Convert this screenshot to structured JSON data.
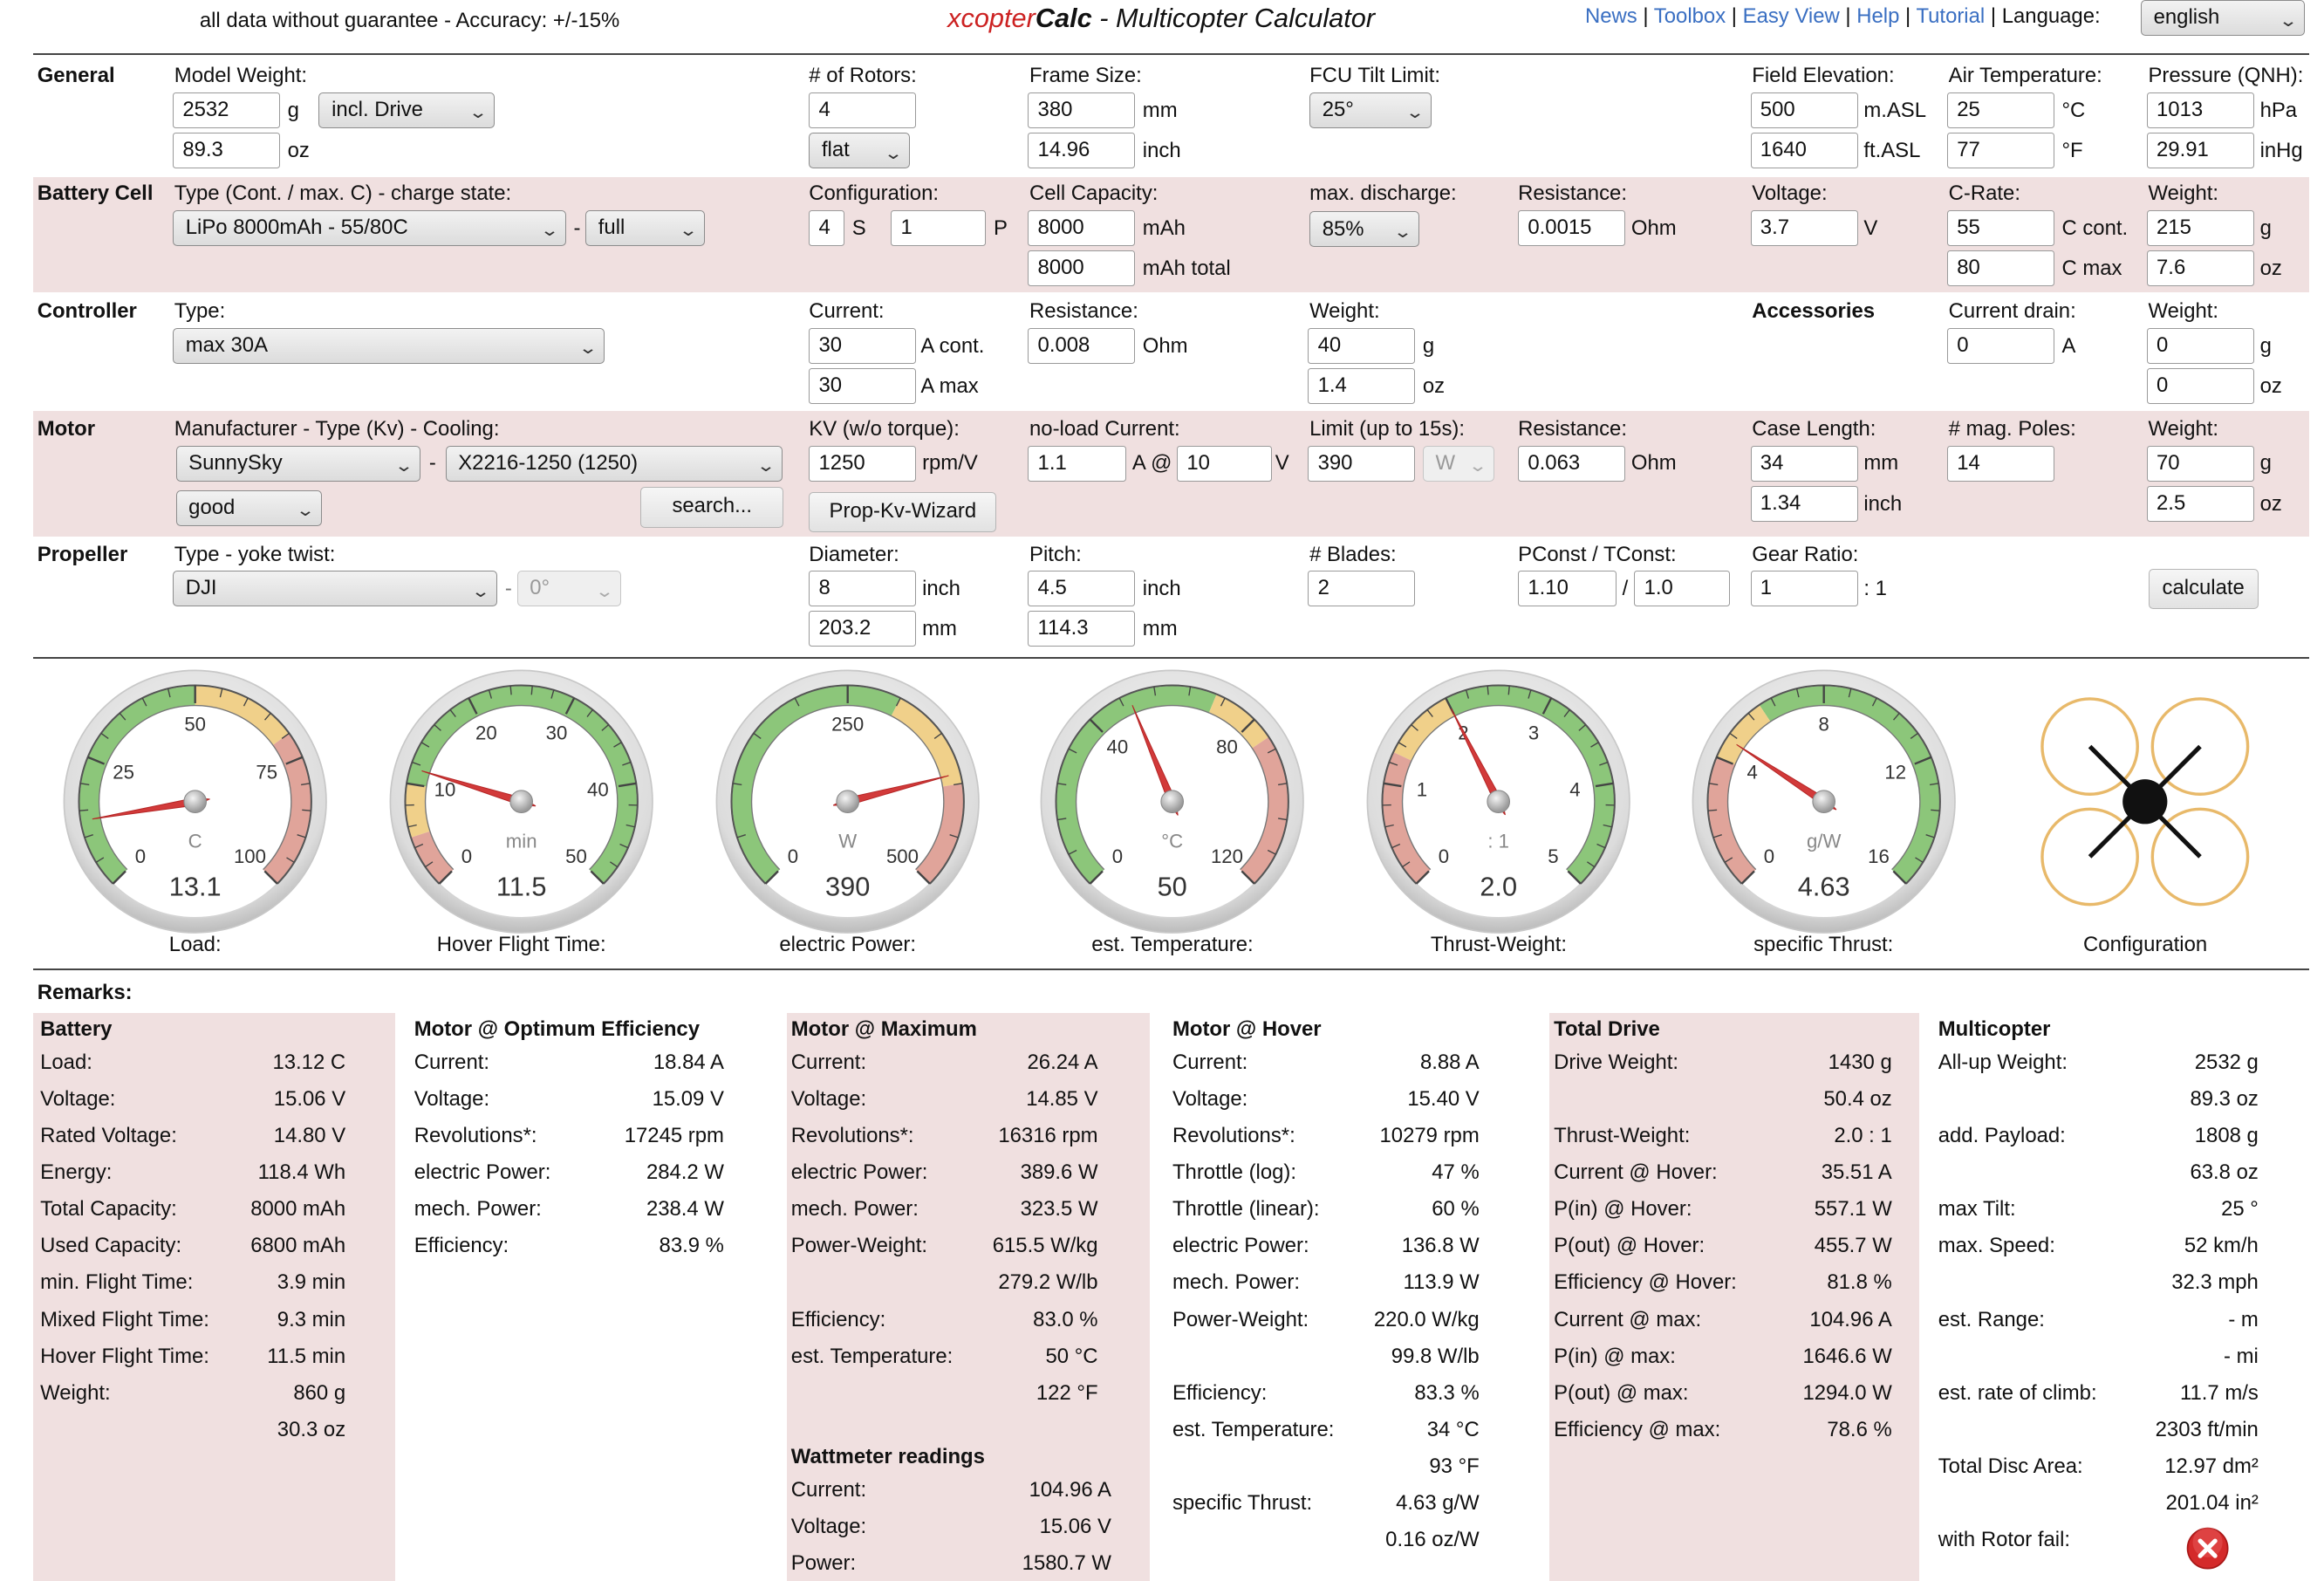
{
  "header": {
    "disclaimer": "all data without guarantee - Accuracy: +/-15%",
    "brand_xcopter": "xcopter",
    "brand_calc": "Calc",
    "brand_rest": " - Multicopter Calculator",
    "nav": [
      "News",
      "Toolbox",
      "Easy View",
      "Help",
      "Tutorial"
    ],
    "language_label": "Language:",
    "language_value": "english"
  },
  "general": {
    "section": "General",
    "model_weight_label": "Model Weight:",
    "model_weight_g": "2532",
    "unit_g": "g",
    "drive_option": "incl. Drive",
    "model_weight_oz": "89.3",
    "unit_oz": "oz",
    "rotors_label": "# of Rotors:",
    "rotors": "4",
    "layout": "flat",
    "frame_label": "Frame Size:",
    "frame_mm": "380",
    "unit_mm": "mm",
    "frame_inch": "14.96",
    "unit_inch": "inch",
    "fcu_label": "FCU Tilt Limit:",
    "fcu_value": "25°",
    "elev_label": "Field Elevation:",
    "elev_m": "500",
    "unit_masl": "m.ASL",
    "elev_ft": "1640",
    "unit_ftasl": "ft.ASL",
    "air_label": "Air Temperature:",
    "air_c": "25",
    "unit_c": "°C",
    "air_f": "77",
    "unit_f": "°F",
    "pressure_label": "Pressure (QNH):",
    "pressure_hpa": "1013",
    "unit_hpa": "hPa",
    "pressure_inhg": "29.91",
    "unit_inhg": "inHg"
  },
  "battery": {
    "section": "Battery Cell",
    "type_label": "Type (Cont. / max. C) - charge state:",
    "type_value": "LiPo 8000mAh - 55/80C",
    "dash": "-",
    "charge_value": "full",
    "config_label": "Configuration:",
    "s_value": "4",
    "unit_s": "S",
    "p_value": "1",
    "unit_p": "P",
    "capacity_label": "Cell Capacity:",
    "capacity": "8000",
    "unit_mah": "mAh",
    "capacity_total": "8000",
    "unit_mah_total": "mAh total",
    "discharge_label": "max. discharge:",
    "discharge_value": "85%",
    "resistance_label": "Resistance:",
    "resistance": "0.0015",
    "unit_ohm": "Ohm",
    "voltage_label": "Voltage:",
    "voltage": "3.7",
    "unit_v": "V",
    "crate_label": "C-Rate:",
    "c_cont": "55",
    "unit_ccont": "C cont.",
    "c_max": "80",
    "unit_cmax": "C max",
    "weight_label": "Weight:",
    "weight_g": "215",
    "weight_oz": "7.6"
  },
  "controller": {
    "section": "Controller",
    "type_label": "Type:",
    "type_value": "max 30A",
    "current_label": "Current:",
    "current_cont": "30",
    "unit_acont": "A cont.",
    "current_max": "30",
    "unit_amax": "A max",
    "resistance_label": "Resistance:",
    "resistance": "0.008",
    "weight_label": "Weight:",
    "weight_g": "40",
    "weight_oz": "1.4",
    "acc_section": "Accessories",
    "drain_label": "Current drain:",
    "drain": "0",
    "unit_a": "A",
    "acc_weight_label": "Weight:",
    "acc_weight_g": "0",
    "acc_weight_oz": "0"
  },
  "motor": {
    "section": "Motor",
    "type_label": "Manufacturer - Type (Kv) - Cooling:",
    "manufacturer": "SunnySky",
    "model": "X2216-1250 (1250)",
    "cooling": "good",
    "search": "search...",
    "kv_label": "KV (w/o torque):",
    "kv": "1250",
    "unit_rpmv": "rpm/V",
    "wizard": "Prop-Kv-Wizard",
    "noload_label": "no-load Current:",
    "noload_a": "1.1",
    "unit_aat": "A @",
    "noload_v": "10",
    "limit_label": "Limit (up to 15s):",
    "limit": "390",
    "limit_unit": "W",
    "resistance_label": "Resistance:",
    "resistance": "0.063",
    "case_label": "Case Length:",
    "case_mm": "34",
    "case_inch": "1.34",
    "poles_label": "# mag. Poles:",
    "poles": "14",
    "weight_label": "Weight:",
    "weight_g": "70",
    "weight_oz": "2.5"
  },
  "propeller": {
    "section": "Propeller",
    "type_label": "Type - yoke twist:",
    "type_value": "DJI",
    "twist": "0°",
    "diameter_label": "Diameter:",
    "diameter_inch": "8",
    "diameter_mm": "203.2",
    "pitch_label": "Pitch:",
    "pitch_inch": "4.5",
    "pitch_mm": "114.3",
    "blades_label": "# Blades:",
    "blades": "2",
    "pconst_label": "PConst / TConst:",
    "pconst": "1.10",
    "slash": "/",
    "tconst": "1.0",
    "gear_label": "Gear Ratio:",
    "gear": "1",
    "gear_unit": ": 1",
    "calculate": "calculate"
  },
  "gauges": [
    {
      "caption": "Load:",
      "unit": "C",
      "value": "13.1",
      "ticks": [
        "0",
        "25",
        "50",
        "75",
        "100"
      ],
      "min": 0,
      "max": 100,
      "needle": 13.1,
      "green": [
        0,
        50
      ],
      "yellow": [
        50,
        70
      ],
      "red": [
        70,
        100
      ]
    },
    {
      "caption": "Hover Flight Time:",
      "unit": "min",
      "value": "11.5",
      "ticks": [
        "0",
        "10",
        "20",
        "30",
        "40",
        "50"
      ],
      "min": 0,
      "max": 50,
      "needle": 11.5,
      "red": [
        0,
        5
      ],
      "yellow": [
        5,
        10
      ],
      "green": [
        10,
        50
      ]
    },
    {
      "caption": "electric Power:",
      "unit": "W",
      "value": "390",
      "ticks": [
        "0",
        "250",
        "500"
      ],
      "min": 0,
      "max": 500,
      "needle": 390,
      "green": [
        0,
        300
      ],
      "yellow": [
        300,
        400
      ],
      "red": [
        400,
        500
      ]
    },
    {
      "caption": "est. Temperature:",
      "unit": "°C",
      "value": "50",
      "ticks": [
        "0",
        "40",
        "80",
        "120"
      ],
      "min": 0,
      "max": 120,
      "needle": 50,
      "green": [
        0,
        70
      ],
      "yellow": [
        70,
        85
      ],
      "red": [
        85,
        120
      ]
    },
    {
      "caption": "Thrust-Weight:",
      "unit": ": 1",
      "value": "2.0",
      "ticks": [
        "0",
        "1",
        "2",
        "3",
        "4",
        "5"
      ],
      "min": 0,
      "max": 5,
      "needle": 2.0,
      "red": [
        0,
        1.3
      ],
      "yellow": [
        1.3,
        2
      ],
      "green": [
        2,
        5
      ]
    },
    {
      "caption": "specific Thrust:",
      "unit": "g/W",
      "value": "4.63",
      "ticks": [
        "0",
        "4",
        "8",
        "12",
        "16"
      ],
      "min": 0,
      "max": 16,
      "needle": 4.63,
      "red": [
        0,
        4
      ],
      "yellow": [
        4,
        6
      ],
      "green": [
        6,
        16
      ]
    }
  ],
  "configuration_caption": "Configuration",
  "remarks": "Remarks:",
  "colors": {
    "red": "#cc2222",
    "link": "#3a6fc2",
    "pink": "#f0e0e0",
    "gauge_green": "#8cc67a",
    "gauge_yellow": "#f0d08a",
    "gauge_red": "#e0a49a"
  },
  "results": {
    "battery": {
      "title": "Battery",
      "rows": [
        [
          "Load:",
          "13.12 C"
        ],
        [
          "Voltage:",
          "15.06 V"
        ],
        [
          "Rated Voltage:",
          "14.80 V"
        ],
        [
          "Energy:",
          "118.4 Wh"
        ],
        [
          "Total Capacity:",
          "8000 mAh"
        ],
        [
          "Used Capacity:",
          "6800 mAh"
        ],
        [
          "min. Flight Time:",
          "3.9 min"
        ],
        [
          "Mixed Flight Time:",
          "9.3 min"
        ],
        [
          "Hover Flight Time:",
          "11.5 min"
        ],
        [
          "Weight:",
          "860 g"
        ],
        [
          "",
          "30.3 oz"
        ]
      ]
    },
    "optimum": {
      "title": "Motor @ Optimum Efficiency",
      "rows": [
        [
          "Current:",
          "18.84 A"
        ],
        [
          "Voltage:",
          "15.09 V"
        ],
        [
          "Revolutions*:",
          "17245 rpm"
        ],
        [
          "electric Power:",
          "284.2 W"
        ],
        [
          "mech. Power:",
          "238.4 W"
        ],
        [
          "Efficiency:",
          "83.9 %"
        ]
      ]
    },
    "maximum": {
      "title": "Motor @ Maximum",
      "rows": [
        [
          "Current:",
          "26.24 A"
        ],
        [
          "Voltage:",
          "14.85 V"
        ],
        [
          "Revolutions*:",
          "16316 rpm"
        ],
        [
          "electric Power:",
          "389.6 W"
        ],
        [
          "mech. Power:",
          "323.5 W"
        ],
        [
          "Power-Weight:",
          "615.5 W/kg"
        ],
        [
          "",
          "279.2 W/lb"
        ],
        [
          "Efficiency:",
          "83.0 %"
        ],
        [
          "est. Temperature:",
          "50 °C"
        ],
        [
          "",
          "122 °F"
        ]
      ]
    },
    "wattmeter": {
      "title": "Wattmeter readings",
      "rows": [
        [
          "Current:",
          "104.96 A"
        ],
        [
          "Voltage:",
          "15.06 V"
        ],
        [
          "Power:",
          "1580.7 W"
        ]
      ]
    },
    "hover": {
      "title": "Motor @ Hover",
      "rows": [
        [
          "Current:",
          "8.88 A"
        ],
        [
          "Voltage:",
          "15.40 V"
        ],
        [
          "Revolutions*:",
          "10279 rpm"
        ],
        [
          "Throttle (log):",
          "47 %"
        ],
        [
          "Throttle (linear):",
          "60 %"
        ],
        [
          "electric Power:",
          "136.8 W"
        ],
        [
          "mech. Power:",
          "113.9 W"
        ],
        [
          "Power-Weight:",
          "220.0 W/kg"
        ],
        [
          "",
          "99.8 W/lb"
        ],
        [
          "Efficiency:",
          "83.3 %"
        ],
        [
          "est. Temperature:",
          "34 °C"
        ],
        [
          "",
          "93 °F"
        ],
        [
          "specific Thrust:",
          "4.63 g/W"
        ],
        [
          "",
          "0.16 oz/W"
        ]
      ]
    },
    "total": {
      "title": "Total Drive",
      "rows": [
        [
          "Drive Weight:",
          "1430 g"
        ],
        [
          "",
          "50.4 oz"
        ],
        [
          "Thrust-Weight:",
          "2.0 : 1"
        ],
        [
          "Current @ Hover:",
          "35.51 A"
        ],
        [
          "P(in) @ Hover:",
          "557.1 W"
        ],
        [
          "P(out) @ Hover:",
          "455.7 W"
        ],
        [
          "Efficiency @ Hover:",
          "81.8 %"
        ],
        [
          "Current @ max:",
          "104.96 A"
        ],
        [
          "P(in) @ max:",
          "1646.6 W"
        ],
        [
          "P(out) @ max:",
          "1294.0 W"
        ],
        [
          "Efficiency @ max:",
          "78.6 %"
        ]
      ]
    },
    "multicopter": {
      "title": "Multicopter",
      "rows": [
        [
          "All-up Weight:",
          "2532 g"
        ],
        [
          "",
          "89.3 oz"
        ],
        [
          "add. Payload:",
          "1808 g"
        ],
        [
          "",
          "63.8 oz"
        ],
        [
          "max Tilt:",
          "25 °"
        ],
        [
          "max. Speed:",
          "52 km/h"
        ],
        [
          "",
          "32.3 mph"
        ],
        [
          "est. Range:",
          "- m"
        ],
        [
          "",
          "- mi"
        ],
        [
          "est. rate of climb:",
          "11.7 m/s"
        ],
        [
          "",
          "2303 ft/min"
        ],
        [
          "Total Disc Area:",
          "12.97 dm²"
        ],
        [
          "",
          "201.04 in²"
        ],
        [
          "with Rotor fail:",
          ""
        ]
      ]
    }
  }
}
